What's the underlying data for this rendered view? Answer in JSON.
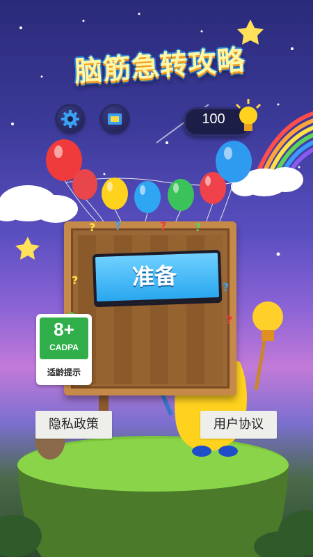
{
  "game": {
    "title": "脑筋急转攻略",
    "coins": "100",
    "ready_label": "准备",
    "settings_icon": "gear-icon",
    "ranking_icon": "badge-icon",
    "hint_icon": "lightbulb-icon"
  },
  "rating": {
    "age": "8+",
    "org": "CADPA",
    "note": "适龄提示"
  },
  "footer": {
    "privacy_label": "隐私政策",
    "terms_label": "用户协议"
  },
  "colors": {
    "sky_top": "#2a2a7a",
    "sky_bottom": "#c27ad8",
    "ready_button": "#2aa7ef",
    "rating_green": "#2fae4a",
    "title_text": "#fff7a8"
  }
}
